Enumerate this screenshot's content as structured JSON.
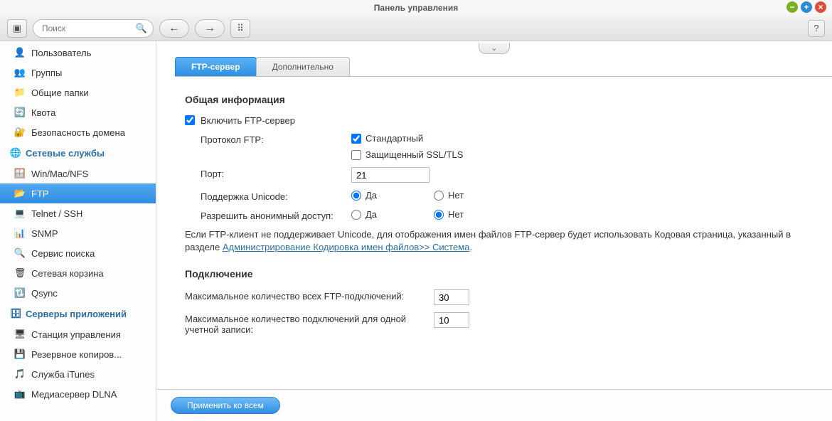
{
  "window": {
    "title": "Панель управления"
  },
  "search": {
    "placeholder": "Поиск"
  },
  "sidebar": {
    "items": [
      {
        "label": "Пользователь",
        "icon": "👤"
      },
      {
        "label": "Группы",
        "icon": "👥"
      },
      {
        "label": "Общие папки",
        "icon": "📁"
      },
      {
        "label": "Квота",
        "icon": "🔄"
      },
      {
        "label": "Безопасность домена",
        "icon": "🔐"
      }
    ],
    "cat_network": {
      "label": "Сетевые службы",
      "icon": "🌐"
    },
    "network_items": [
      {
        "label": "Win/Mac/NFS",
        "icon": "🪟"
      },
      {
        "label": "FTP",
        "icon": "📂"
      },
      {
        "label": "Telnet / SSH",
        "icon": "💻"
      },
      {
        "label": "SNMP",
        "icon": "📊"
      },
      {
        "label": "Сервис поиска",
        "icon": "🔍"
      },
      {
        "label": "Сетевая корзина",
        "icon": "🗑"
      },
      {
        "label": "Qsync",
        "icon": "🔃"
      }
    ],
    "cat_app": {
      "label": "Серверы приложений",
      "icon": "🗄"
    },
    "app_items": [
      {
        "label": "Станция управления",
        "icon": "🖥"
      },
      {
        "label": "Резервное копиров...",
        "icon": "💾"
      },
      {
        "label": "Служба iTunes",
        "icon": "🎵"
      },
      {
        "label": "Медиасервер DLNA",
        "icon": "📺"
      }
    ]
  },
  "tabs": [
    {
      "label": "FTP-сервер",
      "active": true
    },
    {
      "label": "Дополнительно",
      "active": false
    }
  ],
  "section_general": "Общая информация",
  "enable_ftp": "Включить FTP-сервер",
  "protocol": {
    "label": "Протокол FTP:",
    "std": "Стандартный",
    "ssl": "Защищенный SSL/TLS"
  },
  "port": {
    "label": "Порт:",
    "value": "21"
  },
  "unicode": {
    "label": "Поддержка Unicode:",
    "yes": "Да",
    "no": "Нет"
  },
  "anon": {
    "label": "Разрешить анонимный доступ:",
    "yes": "Да",
    "no": "Нет"
  },
  "hint": {
    "pre": "Если FTP-клиент не поддерживает Unicode, для отображения имен файлов FTP-сервер будет использовать Кодовая страница, указанный в разделе ",
    "link": "Администрирование Кодировка имен файлов>> Система",
    "post": "."
  },
  "section_conn": "Подключение",
  "max_all": {
    "label": "Максимальное количество всех FTP-подключений:",
    "value": "30"
  },
  "max_user": {
    "label": "Максимальное количество подключений для одной учетной записи:",
    "value": "10"
  },
  "apply": "Применить ко всем"
}
